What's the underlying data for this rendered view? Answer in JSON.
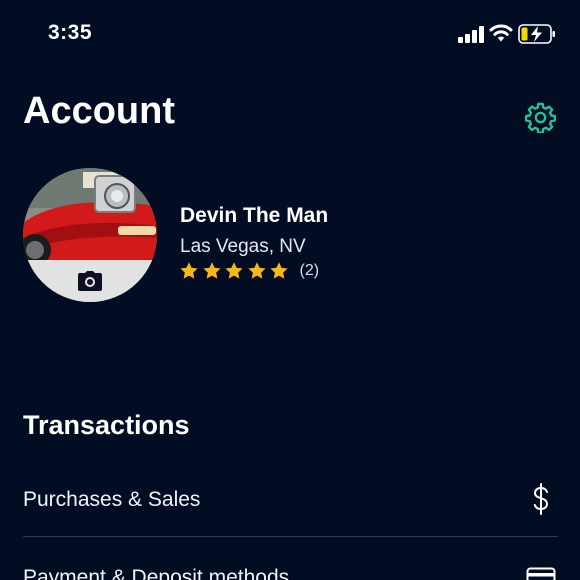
{
  "status_bar": {
    "time": "3:35"
  },
  "header": {
    "title": "Account"
  },
  "profile": {
    "name": "Devin The Man",
    "location": "Las Vegas, NV",
    "rating_stars": 5,
    "review_count": "(2)"
  },
  "transactions": {
    "title": "Transactions",
    "items": [
      {
        "label": "Purchases & Sales",
        "icon": "dollar-icon"
      },
      {
        "label": "Payment & Deposit methods",
        "icon": "credit-card-icon"
      }
    ]
  },
  "colors": {
    "background": "#020d24",
    "accent": "#1fc59a",
    "star": "#f6b817",
    "text": "#ffffff"
  }
}
